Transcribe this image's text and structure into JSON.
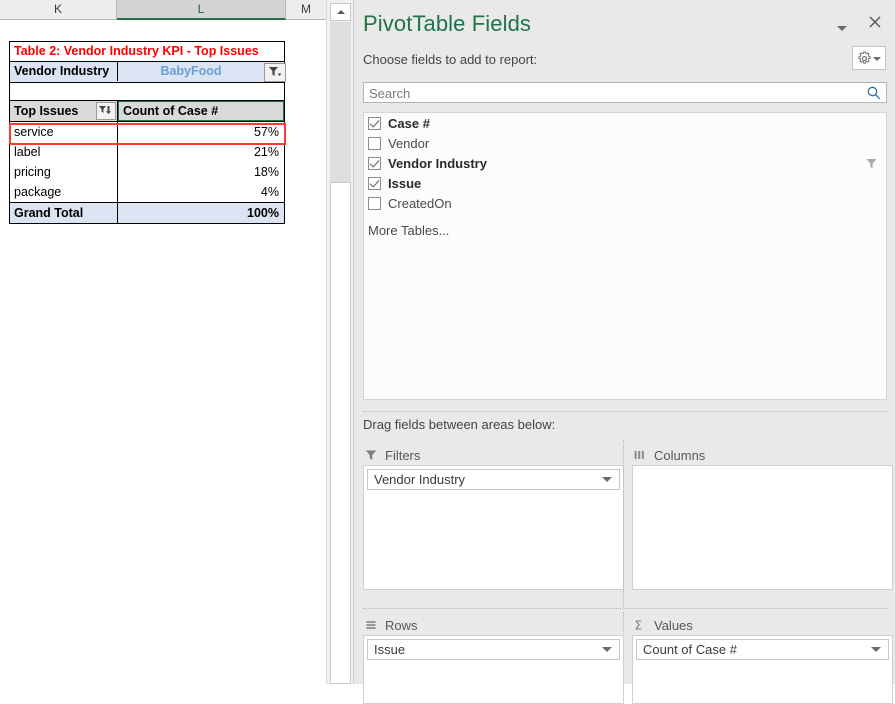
{
  "spreadsheet": {
    "columns": [
      {
        "label": "K",
        "selected": false
      },
      {
        "label": "L",
        "selected": true
      },
      {
        "label": "M",
        "selected": false
      }
    ],
    "pivot_table": {
      "title": "Table 2: Vendor Industry KPI - Top Issues",
      "filter_field_label": "Vendor Industry",
      "filter_field_value": "BabyFood",
      "filter_button_icon": "filter-dropdown-icon",
      "header_row_label": "Top Issues",
      "header_sort_icon": "sort-filter-dropdown-icon",
      "header_value_label": "Count of Case #",
      "rows": [
        {
          "label": "service",
          "value": "57%",
          "highlighted": true
        },
        {
          "label": "label",
          "value": "21%",
          "highlighted": false
        },
        {
          "label": "pricing",
          "value": "18%",
          "highlighted": false
        },
        {
          "label": "package",
          "value": "4%",
          "highlighted": false
        }
      ],
      "total_label": "Grand Total",
      "total_value": "100%"
    },
    "scrollbar": {
      "up_arrow_icon": "scroll-up-arrow-icon"
    }
  },
  "pane": {
    "title": "PivotTable Fields",
    "dropdown_icon": "chevron-down-icon",
    "close_icon": "close-icon",
    "choose_label": "Choose fields to add to report:",
    "gear_icon": "gear-icon",
    "gear_caret_icon": "chevron-down-icon",
    "search": {
      "placeholder": "Search",
      "value": "",
      "icon": "search-icon"
    },
    "fields": [
      {
        "label": "Case #",
        "checked": true,
        "has_filter_icon": false
      },
      {
        "label": "Vendor",
        "checked": false,
        "has_filter_icon": false
      },
      {
        "label": "Vendor Industry",
        "checked": true,
        "has_filter_icon": true
      },
      {
        "label": "Issue",
        "checked": true,
        "has_filter_icon": false
      },
      {
        "label": "CreatedOn",
        "checked": false,
        "has_filter_icon": false
      }
    ],
    "more_tables_label": "More Tables...",
    "drag_label": "Drag fields between areas below:",
    "areas": [
      {
        "name": "Filters",
        "icon": "filter-icon",
        "chips": [
          {
            "label": "Vendor Industry",
            "caret_icon": "chevron-down-icon"
          }
        ]
      },
      {
        "name": "Columns",
        "icon": "columns-icon",
        "chips": []
      },
      {
        "name": "Rows",
        "icon": "rows-icon",
        "chips": [
          {
            "label": "Issue",
            "caret_icon": "chevron-down-icon"
          }
        ]
      },
      {
        "name": "Values",
        "icon": "sigma-icon",
        "chips": [
          {
            "label": "Count of Case #",
            "caret_icon": "chevron-down-icon"
          }
        ]
      }
    ]
  },
  "colors": {
    "excel_green": "#217346",
    "title_red": "#ff0000",
    "filter_value_blue": "#6a9fd8",
    "highlight_red": "#ff3b30",
    "total_band": "#dce3f2",
    "header_gray": "#d9d9d9"
  }
}
